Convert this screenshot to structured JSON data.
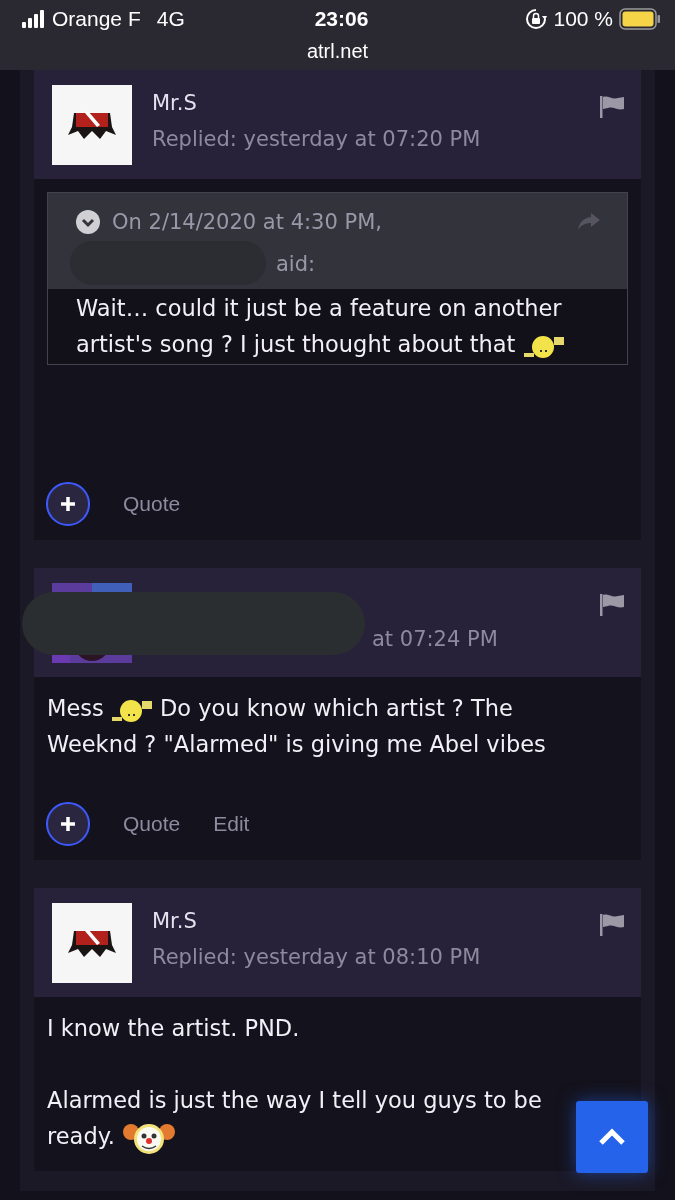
{
  "status_bar": {
    "carrier": "Orange F",
    "network": "4G",
    "time": "23:06",
    "url": "atrl.net",
    "battery": "100 %"
  },
  "posts": [
    {
      "author": "Mr.S",
      "redacted": false,
      "time": "Replied: yesterday at 07:20 PM",
      "quote": {
        "header": "On 2/14/2020 at 4:30 PM,",
        "said": "aid:",
        "redacted": true,
        "paragraphs": [
          [
            {
              "kind": "text",
              "text": "Wait… could it just be a feature on another artist's song ? I just thought about that "
            },
            {
              "kind": "face-emoji"
            }
          ]
        ]
      },
      "actions": [
        "Quote"
      ]
    },
    {
      "redacted": true,
      "time": "at 07:24 PM",
      "paragraphs": [
        [
          {
            "kind": "text",
            "text": "Mess "
          },
          {
            "kind": "face-emoji"
          },
          {
            "kind": "text",
            "text": " Do you know which artist ? The Weeknd ? \"Alarmed\" is giving me Abel vibes"
          }
        ]
      ],
      "actions": [
        "Quote",
        "Edit"
      ]
    },
    {
      "author": "Mr.S",
      "redacted": false,
      "time": "Replied: yesterday at 08:10 PM",
      "paragraphs": [
        [
          {
            "kind": "text",
            "text": "I know the artist. PND."
          }
        ],
        [
          {
            "kind": "text",
            "text": "Alarmed is just the way I tell you guys to be ready. "
          },
          {
            "kind": "clown-emoji"
          }
        ]
      ]
    }
  ]
}
